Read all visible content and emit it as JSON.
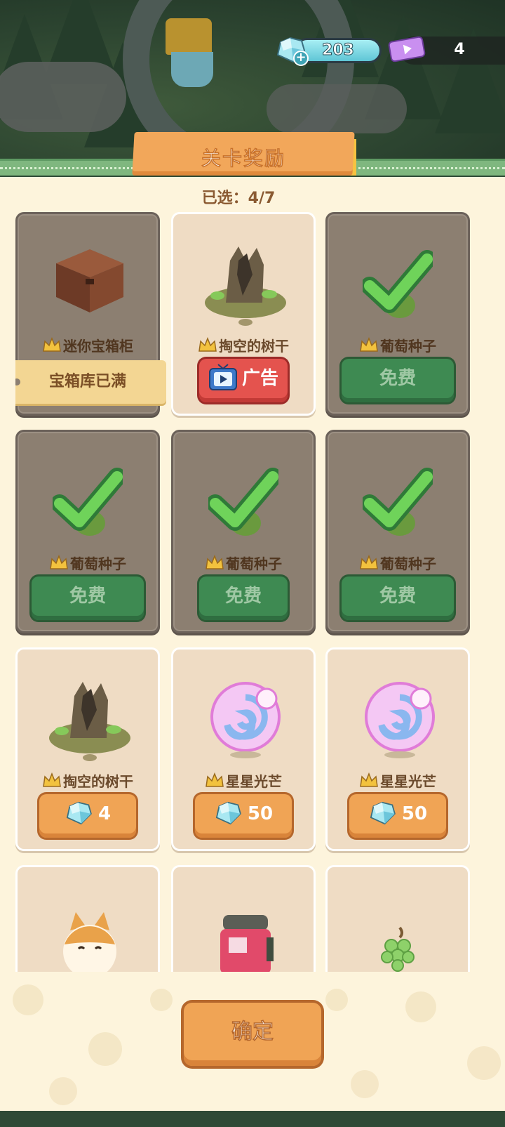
{
  "currency": {
    "gems": "203",
    "tickets": "4"
  },
  "title": "关卡奖励",
  "selected": {
    "label": "已选：4/7"
  },
  "cards": [
    {
      "name": "迷你宝箱柜",
      "level": "1",
      "state": "taken",
      "action": "宝箱库已满",
      "action_type": "full",
      "art": "chest"
    },
    {
      "name": "掏空的树干",
      "level": "2",
      "state": "available",
      "action": "广告",
      "action_type": "ad",
      "art": "stump"
    },
    {
      "name": "葡萄种子",
      "level": "1",
      "state": "taken",
      "action": "免费",
      "action_type": "free",
      "art": "seed"
    },
    {
      "name": "葡萄种子",
      "level": "1",
      "state": "taken",
      "action": "免费",
      "action_type": "free",
      "art": "seed"
    },
    {
      "name": "葡萄种子",
      "level": "1",
      "state": "taken",
      "action": "免费",
      "action_type": "free",
      "art": "seed"
    },
    {
      "name": "葡萄种子",
      "level": "1",
      "state": "taken",
      "action": "免费",
      "action_type": "free",
      "art": "seed"
    },
    {
      "name": "掏空的树干",
      "level": "2",
      "state": "available",
      "action": "4",
      "action_type": "gem",
      "art": "stump"
    },
    {
      "name": "星星光芒",
      "level": "5",
      "state": "available",
      "action": "50",
      "action_type": "gem",
      "art": "orb"
    },
    {
      "name": "星星光芒",
      "level": "5",
      "state": "available",
      "action": "50",
      "action_type": "gem",
      "art": "orb"
    },
    {
      "name": "",
      "level": "",
      "state": "available",
      "action": "",
      "action_type": "none",
      "art": "shiba"
    },
    {
      "name": "",
      "level": "",
      "state": "available",
      "action": "",
      "action_type": "none",
      "art": "jar"
    },
    {
      "name": "",
      "level": "",
      "state": "available",
      "action": "",
      "action_type": "none",
      "art": "grapes"
    }
  ],
  "confirm_label": "确定",
  "colors": {
    "panel": "#fdf4dc",
    "card": "#efdcc4",
    "card_taken": "#8c7f71",
    "green_button": "#3e8a52",
    "orange_button": "#f0a455",
    "red_button": "#e4534e",
    "title_ribbon": "#f2a75a"
  }
}
